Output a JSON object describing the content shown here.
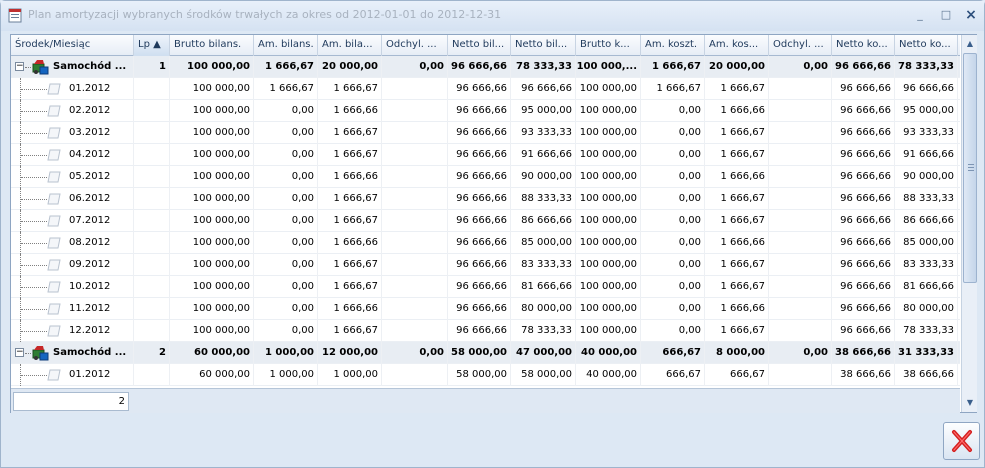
{
  "window": {
    "title": "Plan amortyzacji wybranych środków trwałych za okres od 2012-01-01 do 2012-12-31",
    "minimize_glyph": "_",
    "maximize_glyph": "□",
    "close_glyph": "×"
  },
  "grid": {
    "columns": [
      {
        "label": "Środek/Miesiąc",
        "w": 123
      },
      {
        "label": "Lp ▲",
        "w": 36
      },
      {
        "label": "Brutto bilans.",
        "w": 84
      },
      {
        "label": "Am. bilans.",
        "w": 64
      },
      {
        "label": "Am. bila...",
        "w": 64
      },
      {
        "label": "Odchyl. ...",
        "w": 66
      },
      {
        "label": "Netto bil...",
        "w": 63
      },
      {
        "label": "Netto bil...",
        "w": 65
      },
      {
        "label": "Brutto k...",
        "w": 65
      },
      {
        "label": "Am. koszt.",
        "w": 64
      },
      {
        "label": "Am. kos...",
        "w": 64
      },
      {
        "label": "Odchyl. ...",
        "w": 63
      },
      {
        "label": "Netto ko...",
        "w": 63
      },
      {
        "label": "Netto ko...",
        "w": 63
      }
    ],
    "rows": [
      {
        "type": "group",
        "label": "Samochód ...",
        "cells": [
          "1",
          "100 000,00",
          "1 666,67",
          "20 000,00",
          "0,00",
          "96 666,66",
          "78 333,33",
          "100 000,...",
          "1 666,67",
          "20 000,00",
          "0,00",
          "96 666,66",
          "78 333,33"
        ]
      },
      {
        "type": "item",
        "label": "01.2012",
        "cells": [
          "",
          "100 000,00",
          "1 666,67",
          "1 666,67",
          "",
          "96 666,66",
          "96 666,66",
          "100 000,00",
          "1 666,67",
          "1 666,67",
          "",
          "96 666,66",
          "96 666,66"
        ]
      },
      {
        "type": "item",
        "label": "02.2012",
        "cells": [
          "",
          "100 000,00",
          "0,00",
          "1 666,66",
          "",
          "96 666,66",
          "95 000,00",
          "100 000,00",
          "0,00",
          "1 666,66",
          "",
          "96 666,66",
          "95 000,00"
        ]
      },
      {
        "type": "item",
        "label": "03.2012",
        "cells": [
          "",
          "100 000,00",
          "0,00",
          "1 666,67",
          "",
          "96 666,66",
          "93 333,33",
          "100 000,00",
          "0,00",
          "1 666,67",
          "",
          "96 666,66",
          "93 333,33"
        ]
      },
      {
        "type": "item",
        "label": "04.2012",
        "cells": [
          "",
          "100 000,00",
          "0,00",
          "1 666,67",
          "",
          "96 666,66",
          "91 666,66",
          "100 000,00",
          "0,00",
          "1 666,67",
          "",
          "96 666,66",
          "91 666,66"
        ]
      },
      {
        "type": "item",
        "label": "05.2012",
        "cells": [
          "",
          "100 000,00",
          "0,00",
          "1 666,66",
          "",
          "96 666,66",
          "90 000,00",
          "100 000,00",
          "0,00",
          "1 666,66",
          "",
          "96 666,66",
          "90 000,00"
        ]
      },
      {
        "type": "item",
        "label": "06.2012",
        "cells": [
          "",
          "100 000,00",
          "0,00",
          "1 666,67",
          "",
          "96 666,66",
          "88 333,33",
          "100 000,00",
          "0,00",
          "1 666,67",
          "",
          "96 666,66",
          "88 333,33"
        ]
      },
      {
        "type": "item",
        "label": "07.2012",
        "cells": [
          "",
          "100 000,00",
          "0,00",
          "1 666,67",
          "",
          "96 666,66",
          "86 666,66",
          "100 000,00",
          "0,00",
          "1 666,67",
          "",
          "96 666,66",
          "86 666,66"
        ]
      },
      {
        "type": "item",
        "label": "08.2012",
        "cells": [
          "",
          "100 000,00",
          "0,00",
          "1 666,66",
          "",
          "96 666,66",
          "85 000,00",
          "100 000,00",
          "0,00",
          "1 666,66",
          "",
          "96 666,66",
          "85 000,00"
        ]
      },
      {
        "type": "item",
        "label": "09.2012",
        "cells": [
          "",
          "100 000,00",
          "0,00",
          "1 666,67",
          "",
          "96 666,66",
          "83 333,33",
          "100 000,00",
          "0,00",
          "1 666,67",
          "",
          "96 666,66",
          "83 333,33"
        ]
      },
      {
        "type": "item",
        "label": "10.2012",
        "cells": [
          "",
          "100 000,00",
          "0,00",
          "1 666,67",
          "",
          "96 666,66",
          "81 666,66",
          "100 000,00",
          "0,00",
          "1 666,67",
          "",
          "96 666,66",
          "81 666,66"
        ]
      },
      {
        "type": "item",
        "label": "11.2012",
        "cells": [
          "",
          "100 000,00",
          "0,00",
          "1 666,66",
          "",
          "96 666,66",
          "80 000,00",
          "100 000,00",
          "0,00",
          "1 666,66",
          "",
          "96 666,66",
          "80 000,00"
        ]
      },
      {
        "type": "item",
        "label": "12.2012",
        "cells": [
          "",
          "100 000,00",
          "0,00",
          "1 666,67",
          "",
          "96 666,66",
          "78 333,33",
          "100 000,00",
          "0,00",
          "1 666,67",
          "",
          "96 666,66",
          "78 333,33"
        ]
      },
      {
        "type": "group",
        "label": "Samochód ...",
        "cells": [
          "2",
          "60 000,00",
          "1 000,00",
          "12 000,00",
          "0,00",
          "58 000,00",
          "47 000,00",
          "40 000,00",
          "666,67",
          "8 000,00",
          "0,00",
          "38 666,66",
          "31 333,33"
        ]
      },
      {
        "type": "item",
        "label": "01.2012",
        "cells": [
          "",
          "60 000,00",
          "1 000,00",
          "1 000,00",
          "",
          "58 000,00",
          "58 000,00",
          "40 000,00",
          "666,67",
          "666,67",
          "",
          "38 666,66",
          "38 666,66"
        ]
      }
    ],
    "footer_count": "2"
  },
  "colors": {
    "accent": "#1e395b",
    "close_red": "#d42020"
  },
  "icons": {
    "app": "app-window-icon",
    "group_row": "car-icon",
    "item_row": "document-icon",
    "close_button": "red-x-icon"
  }
}
